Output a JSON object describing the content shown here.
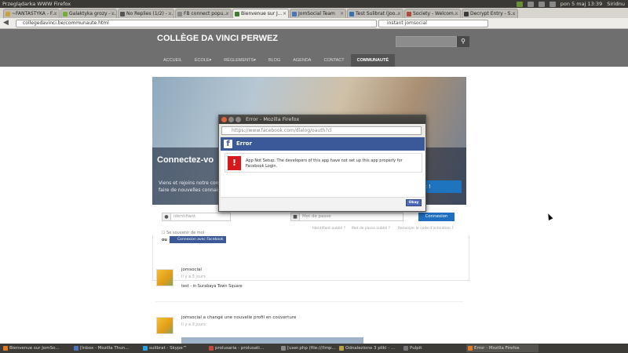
{
  "os": {
    "top_title": "Przeglądarka WWW Firefox",
    "clock": "pon 5 maj 13:39",
    "user": "Siridnu"
  },
  "browser": {
    "tabs": [
      {
        "label": "~FANTASTYKA - F...",
        "active": false
      },
      {
        "label": "Galaktyka grozy - ...",
        "active": false
      },
      {
        "label": "No Replies (1/2) - ...",
        "active": false
      },
      {
        "label": "FB connect popu...",
        "active": false
      },
      {
        "label": "Bienvenue sur J...",
        "active": true
      },
      {
        "label": "JomSocial Team",
        "active": false
      },
      {
        "label": "Test Sulibrat (Joo...",
        "active": false
      },
      {
        "label": "Society - Welcom...",
        "active": false
      },
      {
        "label": "Decrypt Entry - S...",
        "active": false
      }
    ],
    "url": "collegedavinci.be/communaute.html",
    "search_value": "instant jomsocial"
  },
  "site": {
    "title": "COLLÈGE DA VINCI PERWEZ",
    "search_placeholder": "Search...",
    "menu": [
      "ACCUEIL",
      "ÉCOLE▾",
      "RÈGLEMENTS▾",
      "BLOG",
      "AGENDA",
      "CONTACT",
      "COMMUNAUTÉ"
    ],
    "hero_title": "Connectez-vo",
    "hero_text": "Viens et rejoins notre comm faire de nouvelles connais",
    "hero_button": "nant !",
    "login": {
      "username_placeholder": "Identifiant",
      "password_placeholder": "Mot de passe",
      "connect": "Connexion",
      "forgot_user": "Identifiant oublié ?",
      "forgot_pass": "Mot de passe oublié ?",
      "resend": "Renvoyer le code d'activation ?",
      "remember": "Se souvenir de moi",
      "or": "ou",
      "fb_connect": "Connexion avec Facebook"
    },
    "posts": [
      {
        "name": "jomsocial",
        "time": "Il y a 3 jours",
        "text": "test - in Surabaya Town Square"
      },
      {
        "name": "jomsocial a changé une nouvelle profil en couverture",
        "time": "Il y a 3 jours",
        "text": ""
      }
    ]
  },
  "popup": {
    "title": "Error - Mozilla Firefox",
    "url": "https://www.facebook.com/dialog/oauth?cl",
    "header": "Error",
    "message": "App Not Setup: The developers of this app have not set up this app properly for Facebook Login.",
    "ok": "Okay"
  },
  "taskbar": [
    {
      "label": "Bienvenue sur JomSo..."
    },
    {
      "label": "[Inbox - Mozilla Thun..."
    },
    {
      "label": "sulibrat - Skype™"
    },
    {
      "label": "prolusaria - prolusati..."
    },
    {
      "label": "[user.php (file:///tmp..."
    },
    {
      "label": "Odnaleziono 3 pliki - ..."
    },
    {
      "label": "Pulpit"
    },
    {
      "label": "Error - Mozilla Firefox"
    }
  ]
}
